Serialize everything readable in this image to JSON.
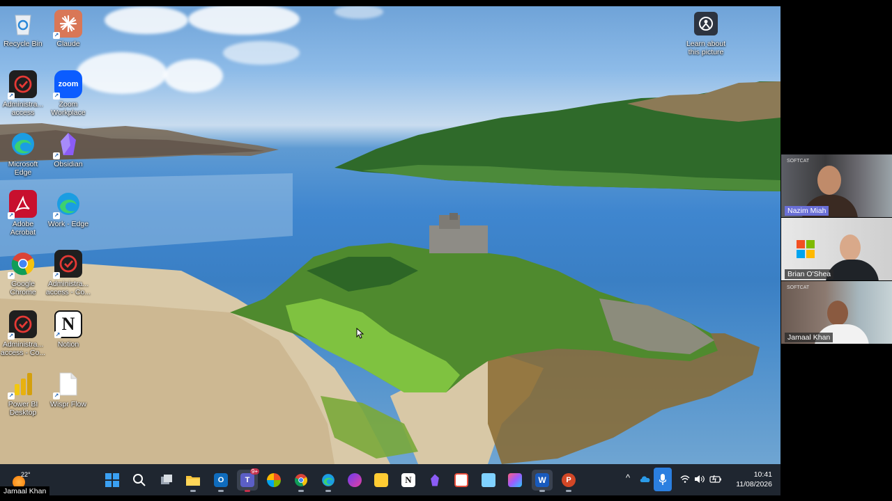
{
  "desktop_icons": [
    {
      "label": "Recycle Bin",
      "icon": "recycle-bin-icon"
    },
    {
      "label": "Claude",
      "icon": "claude-icon",
      "color": "#d97757"
    },
    {
      "label": "Administra... access",
      "icon": "admin-access-icon"
    },
    {
      "label": "Zoom Workplace",
      "icon": "zoom-icon",
      "color": "#0b5cff",
      "tile_text": "zoom"
    },
    {
      "label": "Microsoft Edge",
      "icon": "edge-icon"
    },
    {
      "label": "Obsidian",
      "icon": "obsidian-icon",
      "color": "#7c3aed"
    },
    {
      "label": "Adobe Acrobat",
      "icon": "acrobat-icon",
      "color": "#c8102e"
    },
    {
      "label": "Work - Edge",
      "icon": "edge-work-icon"
    },
    {
      "label": "Google Chrome",
      "icon": "chrome-icon"
    },
    {
      "label": "Administra... access - Co...",
      "icon": "admin-access-icon"
    },
    {
      "label": "Administra... access - Co...",
      "icon": "admin-access-icon"
    },
    {
      "label": "Notion",
      "icon": "notion-icon",
      "tile_text": "N"
    },
    {
      "label": "Power BI Desktop",
      "icon": "powerbi-icon",
      "color": "#f2c811"
    },
    {
      "label": "Wispr Flow",
      "icon": "file-icon"
    }
  ],
  "learn_picture": {
    "label": "Learn about this picture",
    "icon": "camera-icon"
  },
  "taskbar": {
    "weather": {
      "temp": "22°",
      "icon": "weather-sun-icon"
    },
    "teams_badge": "9+",
    "apps": [
      "windows-start-icon",
      "search-icon",
      "task-view-icon",
      "file-explorer-icon",
      "outlook-icon",
      "teams-icon",
      "m365-icon",
      "chrome-icon",
      "edge-icon",
      "copilot-icon",
      "sticky-notes-icon",
      "notion-icon",
      "obsidian-icon",
      "snipping-tool-icon",
      "notepad-icon",
      "photos-icon",
      "word-icon",
      "powerpoint-icon"
    ],
    "tray": {
      "chevron": "^",
      "clock_time": "10:41",
      "clock_date": "11/08/2026"
    }
  },
  "bottom_name": "Jamaal Khan",
  "participants": [
    {
      "name": "Nazim Miah",
      "highlighted": true
    },
    {
      "name": "Brian O'Shea",
      "highlighted": false
    },
    {
      "name": "Jamaal Khan",
      "highlighted": false
    }
  ],
  "participant_brand": "SOFTCAT",
  "colors": {
    "taskbar": "#1f2630",
    "accent": "#2b7fe0",
    "speaker": "#6a6fd6"
  }
}
